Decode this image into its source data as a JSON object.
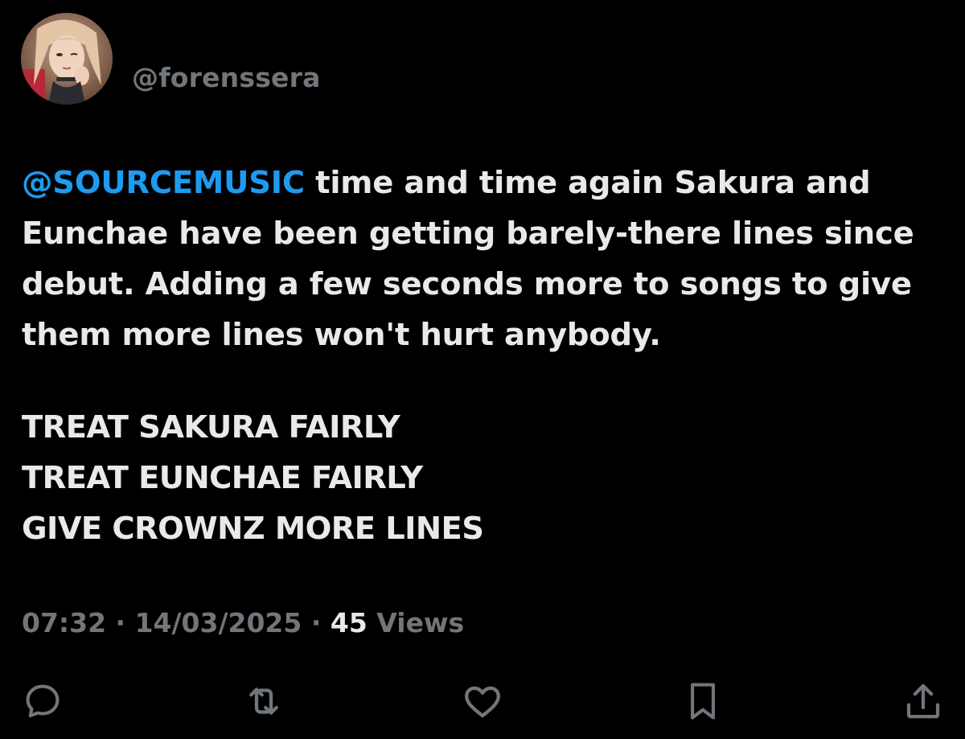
{
  "tweet": {
    "handle": "@forenssera",
    "mention": "@SOURCEMUSIC",
    "text": " time and time again Sakura and Eunchae have been getting barely-there lines since debut. Adding a few seconds more to songs to give them more lines won't hurt anybody.",
    "shout_lines": [
      "TREAT SAKURA FAIRLY",
      "TREAT EUNCHAE FAIRLY",
      "GIVE CROWNZ MORE LINES"
    ],
    "time": "07:32",
    "separator": " · ",
    "date": "14/03/2025",
    "views_count": "45",
    "views_label": " Views"
  },
  "actions": [
    {
      "name": "reply",
      "icon": "reply-icon"
    },
    {
      "name": "retweet",
      "icon": "retweet-icon"
    },
    {
      "name": "like",
      "icon": "heart-icon"
    },
    {
      "name": "bookmark",
      "icon": "bookmark-icon"
    },
    {
      "name": "share",
      "icon": "share-icon"
    }
  ],
  "colors": {
    "background": "#000000",
    "text": "#e7e9ea",
    "muted": "#71767b",
    "mention": "#1d9bf0"
  }
}
